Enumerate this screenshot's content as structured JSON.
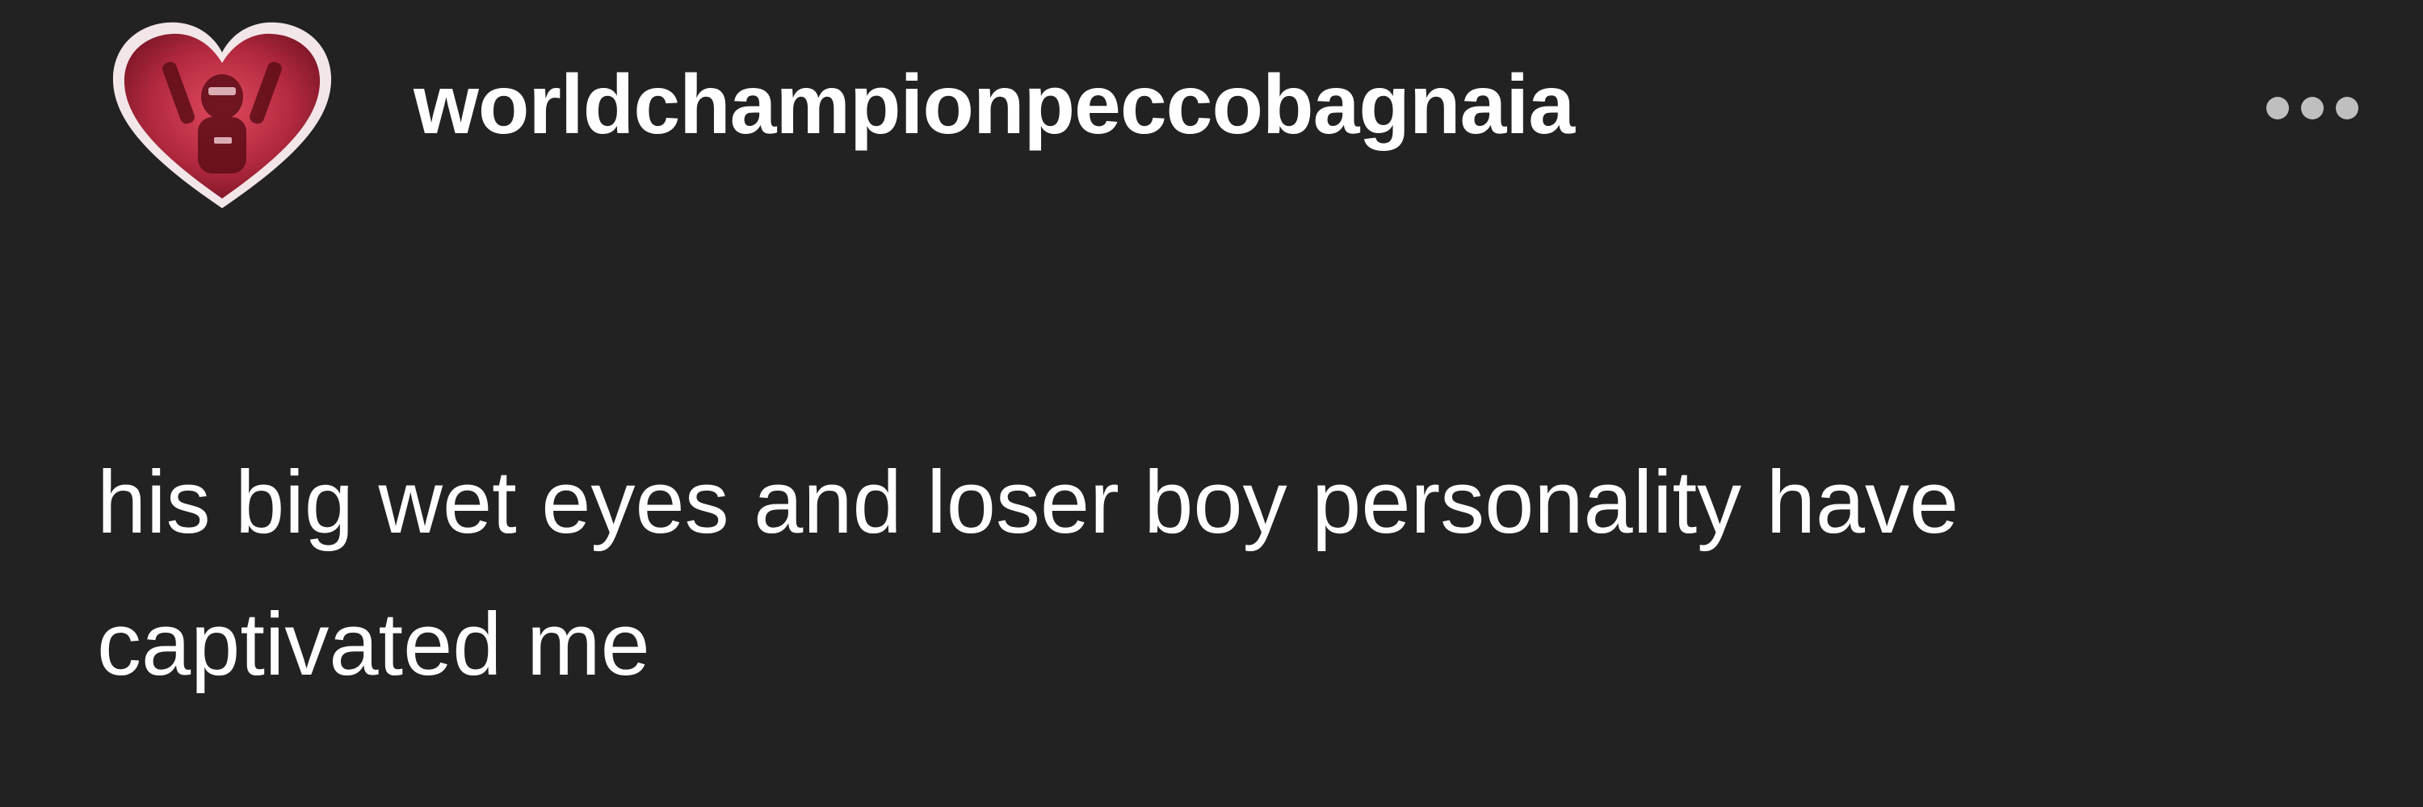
{
  "post": {
    "username": "worldchampionpeccobagnaia",
    "avatar_icon": "heart-avatar-icon",
    "more_icon": "more-options-icon",
    "text_line_1": "his big wet eyes and loser boy personality have",
    "text_line_2": "captivated me"
  },
  "colors": {
    "background": "#222222",
    "text": "#ffffff",
    "avatar_heart": "#b3293f",
    "more_dots": "#bfbfbf"
  }
}
